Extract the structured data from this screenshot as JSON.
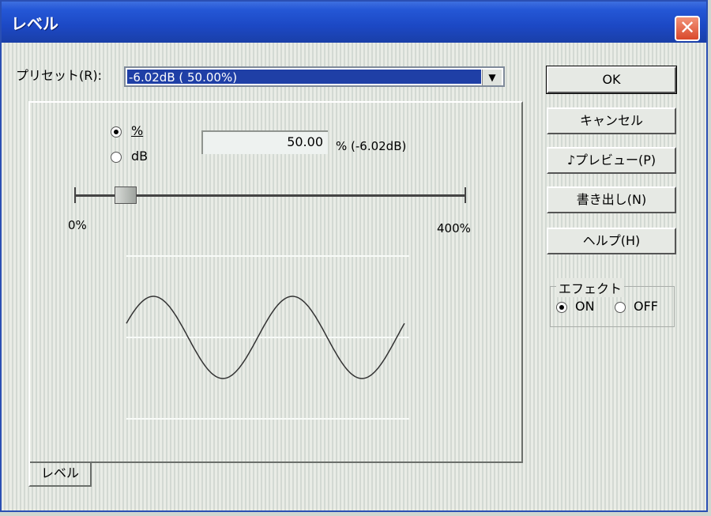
{
  "window": {
    "title": "レベル"
  },
  "preset": {
    "label": "プリセット(R):",
    "selected": "-6.02dB (  50.00%)"
  },
  "options": {
    "percent_label": "%",
    "db_label": "dB",
    "selected": "percent"
  },
  "level": {
    "value": "50.00",
    "unit_text": "% (-6.02dB)",
    "fraction": 0.125
  },
  "slider": {
    "min_label": "0%",
    "max_label": "400%"
  },
  "tab": {
    "label": "レベル"
  },
  "buttons": {
    "ok": "OK",
    "cancel": "キャンセル",
    "preview": "♪プレビュー(P)",
    "export": "書き出し(N)",
    "help": "ヘルプ(H)"
  },
  "effect": {
    "title": "エフェクト",
    "on_label": "ON",
    "off_label": "OFF",
    "selected": "on"
  },
  "colors": {
    "titlebar": "#2457d6",
    "selection": "#1f3fa6",
    "close": "#d9482a"
  }
}
